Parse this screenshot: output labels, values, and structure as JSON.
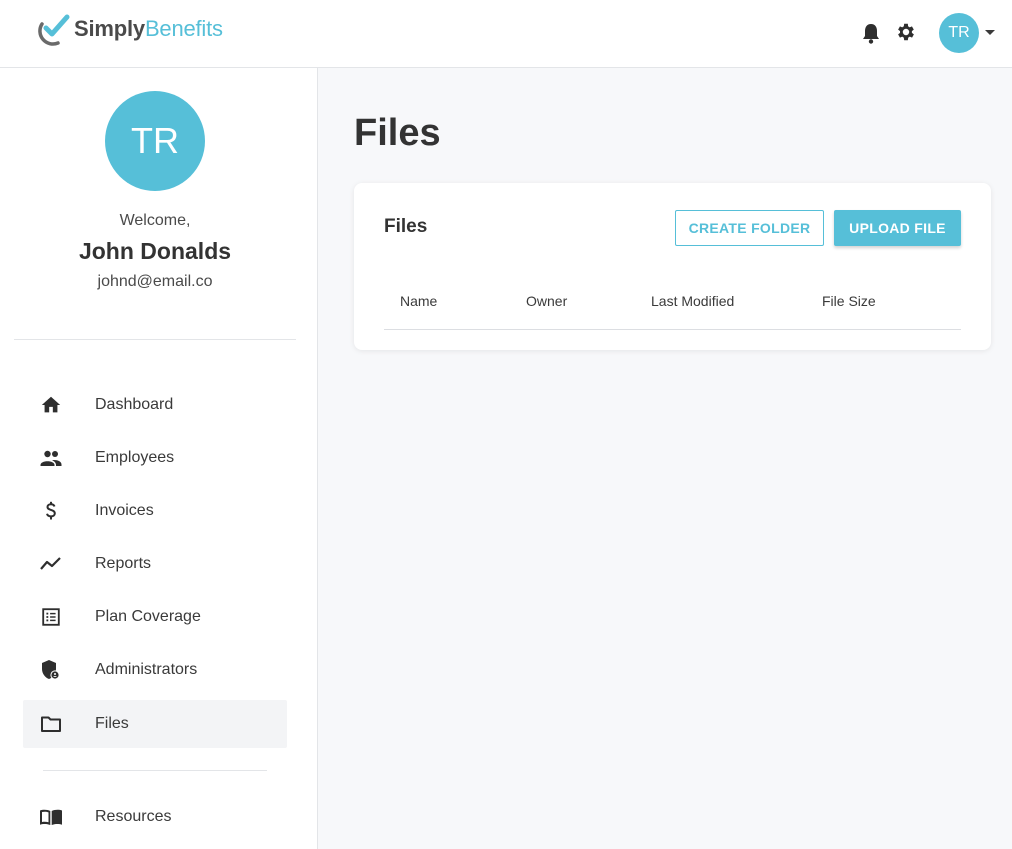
{
  "header": {
    "logo_simply": "Simply",
    "logo_benefits": "Benefits",
    "avatar_initials": "TR",
    "icons": [
      "bell-icon",
      "gear-icon",
      "chevron-down-icon"
    ]
  },
  "sidebar": {
    "avatar_initials": "TR",
    "welcome": "Welcome,",
    "name": "John Donalds",
    "email": "johnd@email.co",
    "items": [
      {
        "label": "Dashboard",
        "icon": "home-icon"
      },
      {
        "label": "Employees",
        "icon": "people-icon"
      },
      {
        "label": "Invoices",
        "icon": "dollar-icon"
      },
      {
        "label": "Reports",
        "icon": "trend-icon"
      },
      {
        "label": "Plan Coverage",
        "icon": "list-icon"
      },
      {
        "label": "Administrators",
        "icon": "shield-icon"
      },
      {
        "label": "Files",
        "icon": "folder-icon",
        "active": true
      },
      {
        "label": "Resources",
        "icon": "book-icon"
      }
    ]
  },
  "main": {
    "title": "Files",
    "card": {
      "title": "Files",
      "create_folder": "CREATE FOLDER",
      "upload_file": "UPLOAD FILE",
      "columns": [
        "Name",
        "Owner",
        "Last Modified",
        "File Size"
      ]
    }
  },
  "colors": {
    "accent": "#56bfd8",
    "text": "#3a3a3a",
    "background": "#f7f8fa"
  }
}
